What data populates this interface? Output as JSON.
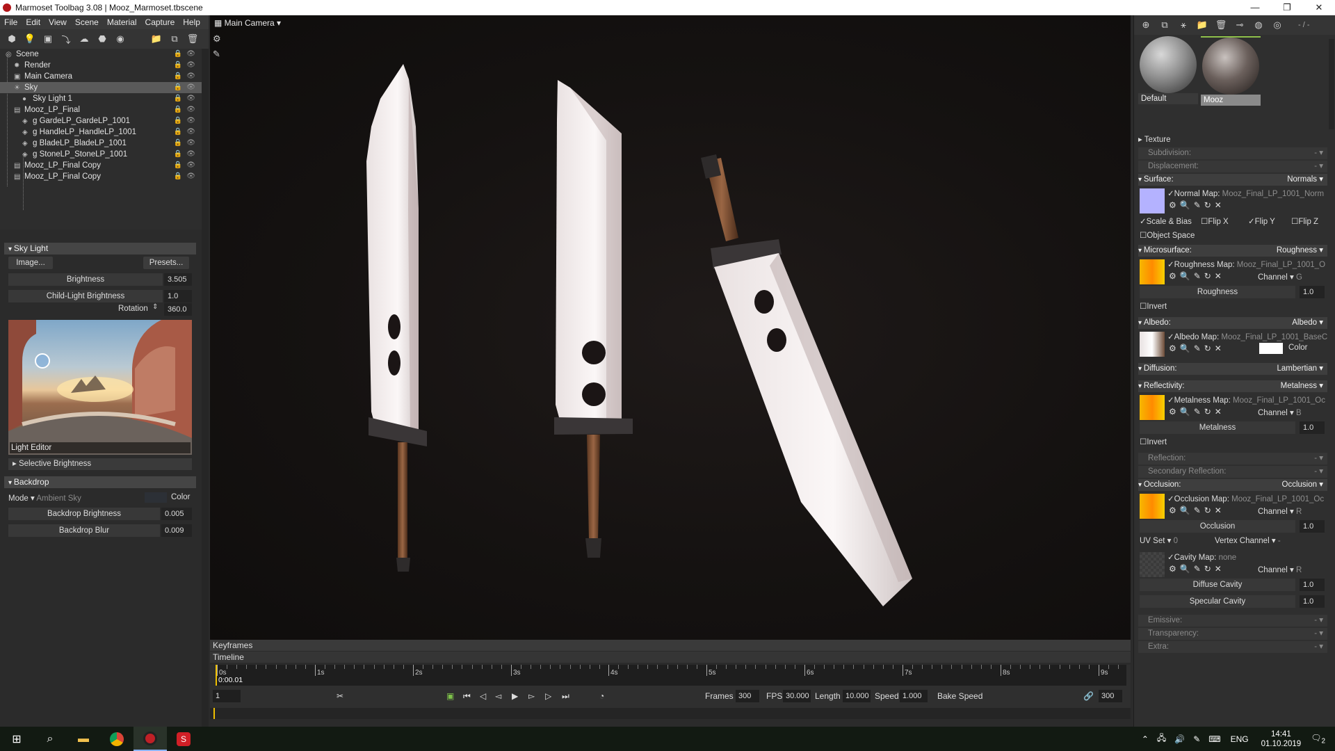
{
  "window": {
    "title": "Marmoset Toolbag 3.08  |  Mooz_Marmoset.tbscene",
    "minimize": "—",
    "restore": "❐",
    "close": "✕"
  },
  "menu": [
    "File",
    "Edit",
    "View",
    "Scene",
    "Material",
    "Capture",
    "Help"
  ],
  "scene_tree": [
    {
      "label": "Scene",
      "icon": "scene-icon",
      "indent": 0
    },
    {
      "label": "Render",
      "icon": "render-icon",
      "indent": 1
    },
    {
      "label": "Main Camera",
      "icon": "camera-icon",
      "indent": 1
    },
    {
      "label": "Sky",
      "icon": "sky-icon",
      "indent": 1,
      "selected": true
    },
    {
      "label": "Sky Light 1",
      "icon": "light-icon",
      "indent": 2
    },
    {
      "label": "Mooz_LP_Final",
      "icon": "mesh-icon",
      "indent": 1
    },
    {
      "label": "g GardeLP_GardeLP_1001",
      "icon": "submesh-icon",
      "indent": 2
    },
    {
      "label": "g HandleLP_HandleLP_1001",
      "icon": "submesh-icon",
      "indent": 2
    },
    {
      "label": "g BladeLP_BladeLP_1001",
      "icon": "submesh-icon",
      "indent": 2
    },
    {
      "label": "g StoneLP_StoneLP_1001",
      "icon": "submesh-icon",
      "indent": 2
    },
    {
      "label": "Mooz_LP_Final Copy",
      "icon": "mesh-icon",
      "indent": 1
    },
    {
      "label": "Mooz_LP_Final Copy",
      "icon": "mesh-icon",
      "indent": 1
    }
  ],
  "sky_light": {
    "title": "Sky Light",
    "image_button": "Image...",
    "presets_button": "Presets...",
    "brightness_label": "Brightness",
    "brightness_value": "3.505",
    "child_label": "Child-Light Brightness",
    "child_value": "1.0",
    "rotation_label": "Rotation",
    "rotation_value": "360.0",
    "light_editor": "Light Editor",
    "selective_brightness": "Selective Brightness"
  },
  "backdrop": {
    "title": "Backdrop",
    "mode_label": "Mode",
    "mode_value": "Ambient Sky",
    "color_label": "Color",
    "brightness_label": "Backdrop Brightness",
    "brightness_value": "0.005",
    "blur_label": "Backdrop Blur",
    "blur_value": "0.009"
  },
  "viewport": {
    "camera": "Main Camera"
  },
  "timeline": {
    "keyframes": "Keyframes",
    "timeline": "Timeline",
    "current": "0:00.01",
    "frame": "1",
    "ticks": [
      "0s",
      "1s",
      "2s",
      "3s",
      "4s",
      "5s",
      "6s",
      "7s",
      "8s",
      "9s"
    ],
    "frames_label": "Frames",
    "frames_value": "300",
    "fps_label": "FPS",
    "fps_value": "30.000",
    "length_label": "Length",
    "length_value": "10.000",
    "speed_label": "Speed",
    "speed_value": "1.000",
    "bake_speed": "Bake Speed",
    "end_value": "300"
  },
  "materials": [
    {
      "name": "Default"
    },
    {
      "name": "Mooz",
      "selected": true
    }
  ],
  "mat_toolbar_label": "- / -",
  "material": {
    "texture": "Texture",
    "subdivision": "Subdivision:",
    "displacement": "Displacement:",
    "dash": "-",
    "surface": "Surface:",
    "surface_val": "Normals",
    "normal_map_label": "Normal Map:",
    "normal_map_file": "Mooz_Final_LP_1001_Norm",
    "scale_bias": "Scale & Bias",
    "flip_x": "Flip X",
    "flip_y": "Flip Y",
    "flip_z": "Flip Z",
    "object_space": "Object Space",
    "microsurface": "Microsurface:",
    "microsurface_val": "Roughness",
    "roughness_map_label": "Roughness Map:",
    "roughness_map_file": "Mooz_Final_LP_1001_O",
    "roughness_channel": "Channel",
    "roughness_channel_val": "G",
    "roughness_label": "Roughness",
    "roughness_value": "1.0",
    "invert": "Invert",
    "albedo": "Albedo:",
    "albedo_val": "Albedo",
    "albedo_map_label": "Albedo Map:",
    "albedo_map_file": "Mooz_Final_LP_1001_BaseC",
    "color": "Color",
    "diffusion": "Diffusion:",
    "diffusion_val": "Lambertian",
    "reflectivity": "Reflectivity:",
    "reflectivity_val": "Metalness",
    "metal_map_label": "Metalness Map:",
    "metal_map_file": "Mooz_Final_LP_1001_Oc",
    "metal_channel_val": "B",
    "metalness_label": "Metalness",
    "metalness_value": "1.0",
    "reflection": "Reflection:",
    "secondary": "Secondary Reflection:",
    "occlusion": "Occlusion:",
    "occlusion_val": "Occlusion",
    "occ_map_label": "Occlusion Map:",
    "occ_map_file": "Mooz_Final_LP_1001_Oc",
    "occ_channel_val": "R",
    "occlusion_label": "Occlusion",
    "occlusion_value": "1.0",
    "uvset": "UV Set",
    "uvset_val": "0",
    "vertex_channel": "Vertex Channel",
    "vertex_channel_val": "-",
    "cavity_map_label": "Cavity Map:",
    "cavity_map_file": "none",
    "cavity_channel_val": "R",
    "diffuse_cavity": "Diffuse Cavity",
    "diffuse_cavity_value": "1.0",
    "specular_cavity": "Specular Cavity",
    "specular_cavity_value": "1.0",
    "emissive": "Emissive:",
    "transparency": "Transparency:",
    "extra": "Extra:"
  },
  "taskbar": {
    "lang": "ENG",
    "time": "14:41",
    "date": "01.10.2019",
    "notif": "2"
  }
}
